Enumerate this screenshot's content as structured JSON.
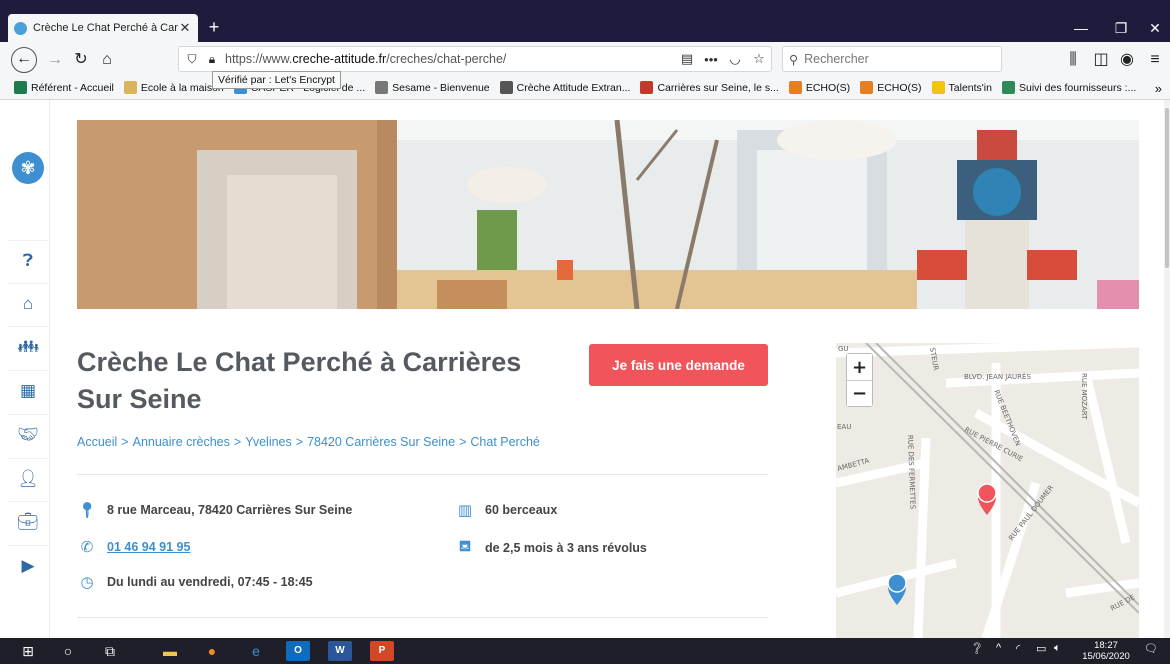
{
  "browser": {
    "tab_title": "Crèche Le Chat Perché à Carrières",
    "tab_close": "✕",
    "new_tab": "+",
    "url_prefix": "https://www.",
    "url_domain": "creche-attitude.fr",
    "url_path": "/creches/chat-perche/",
    "tooltip": "Vérifié par : Let's Encrypt",
    "search_placeholder": "Rechercher",
    "overflow_menu": "•••",
    "bookmarks": [
      {
        "label": "Référent - Accueil",
        "color": "#1f7a4d"
      },
      {
        "label": "Ecole à la maison",
        "color": "#d9b45a"
      },
      {
        "label": "CASPER - Logiciel de ...",
        "color": "#3d8fd1"
      },
      {
        "label": "Sesame - Bienvenue",
        "color": "#777777"
      },
      {
        "label": "Crèche Attitude Extran...",
        "color": "#555555"
      },
      {
        "label": "Carrières sur Seine, le s...",
        "color": "#c0392b"
      },
      {
        "label": "ECHO(S)",
        "color": "#e67e22"
      },
      {
        "label": "ECHO(S)",
        "color": "#e67e22"
      },
      {
        "label": "Talents'in",
        "color": "#f1c40f"
      },
      {
        "label": "Suivi des fournisseurs :...",
        "color": "#2e8b57"
      }
    ],
    "bookmarks_more": "»"
  },
  "page": {
    "title": "Crèche Le Chat Perché à Carrières Sur Seine",
    "cta_label": "Je fais une demande",
    "breadcrumb": [
      "Accueil",
      "Annuaire crèches",
      "Yvelines",
      "78420 Carrières Sur Seine",
      "Chat Perché"
    ],
    "breadcrumb_sep": ">",
    "address": "8 rue Marceau, 78420 Carrières Sur Seine",
    "phone": "01 46 94 91 95",
    "hours": "Du lundi au vendredi, 07:45 - 18:45",
    "capacity": "60 berceaux",
    "age_range": "de 2,5 mois à 3 ans révolus"
  },
  "map": {
    "zoom_in": "+",
    "zoom_out": "−",
    "streets": [
      "BLVD. JEAN JAURÈS",
      "RUE MOZART",
      "RUE BEETHOVEN",
      "RUE PIERRE CURIE",
      "RUE DES FERMETTES",
      "RUE PAUL DOUMER",
      "STEUR",
      "AMBETTA",
      "EAU",
      "RUE DE",
      "GU"
    ]
  },
  "taskbar": {
    "time": "18:27",
    "date": "15/06/2020",
    "apps": [
      {
        "label": "O",
        "color": "#0f6cbd"
      },
      {
        "label": "W",
        "color": "#2b579a"
      },
      {
        "label": "P",
        "color": "#d24726"
      }
    ]
  },
  "colors": {
    "accent": "#3d8fd1",
    "cta": "#f2545b",
    "heading": "#555a60",
    "chrome_dark": "#1e1b3c"
  }
}
